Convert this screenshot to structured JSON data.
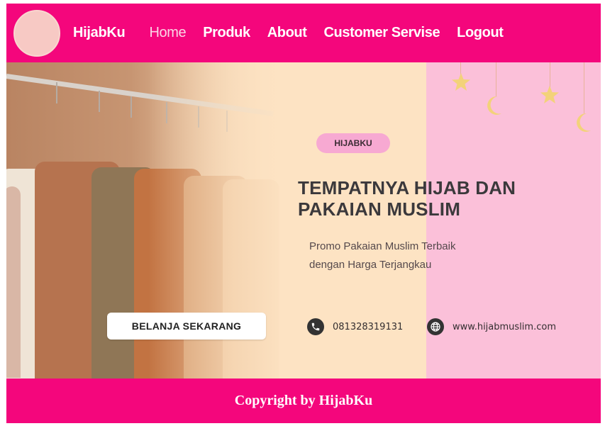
{
  "navbar": {
    "brand": "HijabKu",
    "links": [
      {
        "label": "Home",
        "active": true
      },
      {
        "label": "Produk",
        "active": false
      },
      {
        "label": "About",
        "active": false
      },
      {
        "label": "Customer Servise",
        "active": false
      },
      {
        "label": "Logout",
        "active": false
      }
    ]
  },
  "hero": {
    "badge": "HIJABKU",
    "headline_line1": "TEMPATNYA HIJAB DAN",
    "headline_line2": "PAKAIAN MUSLIM",
    "promo_line1": "Promo Pakaian Muslim Terbaik",
    "promo_line2": "dengan Harga Terjangkau",
    "cta_label": "BELANJA SEKARANG",
    "phone": "081328319131",
    "website": "www.hijabmuslim.com",
    "icons": {
      "phone": "phone-icon",
      "website": "globe-icon"
    }
  },
  "footer": {
    "copyright": "Copyright by HijabKu"
  },
  "colors": {
    "brand_pink": "#f4067c",
    "hero_cream": "#fde3c3",
    "hero_pink": "#fbc0d9",
    "badge_pink": "#f7a9d2",
    "star_yellow": "#f3d27a"
  }
}
